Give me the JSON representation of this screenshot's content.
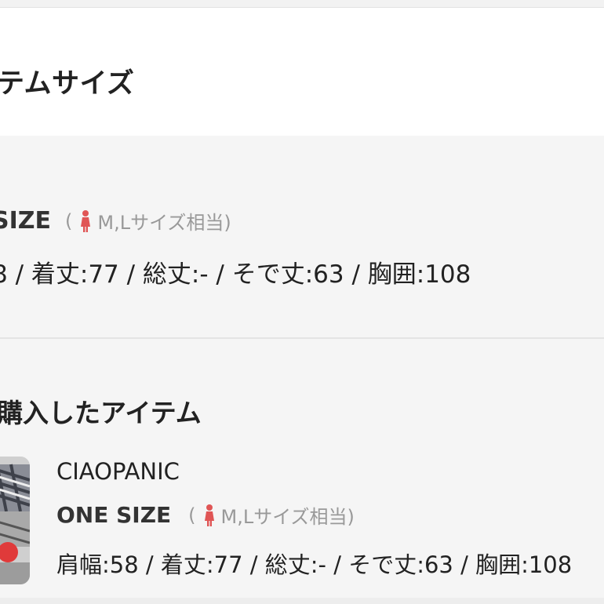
{
  "header": {
    "title": "テムサイズ"
  },
  "size_info": {
    "size_name": "SIZE",
    "equiv_open": "(",
    "equiv_text": "M,Lサイズ相当)",
    "measurements": "8 / 着丈:77 / 総丈:- / そで丈:63 / 胸囲:108"
  },
  "purchased": {
    "title": "購入したアイテム",
    "item": {
      "brand": "CIAOPANIC",
      "size_name": "ONE SIZE",
      "equiv_open": "(",
      "equiv_text": "M,Lサイズ相当)",
      "measurements": "肩幅:58 / 着丈:77 / 総丈:- / そで丈:63 / 胸囲:108"
    }
  },
  "colors": {
    "accent_red": "#e05555",
    "muted_text": "#999999"
  }
}
